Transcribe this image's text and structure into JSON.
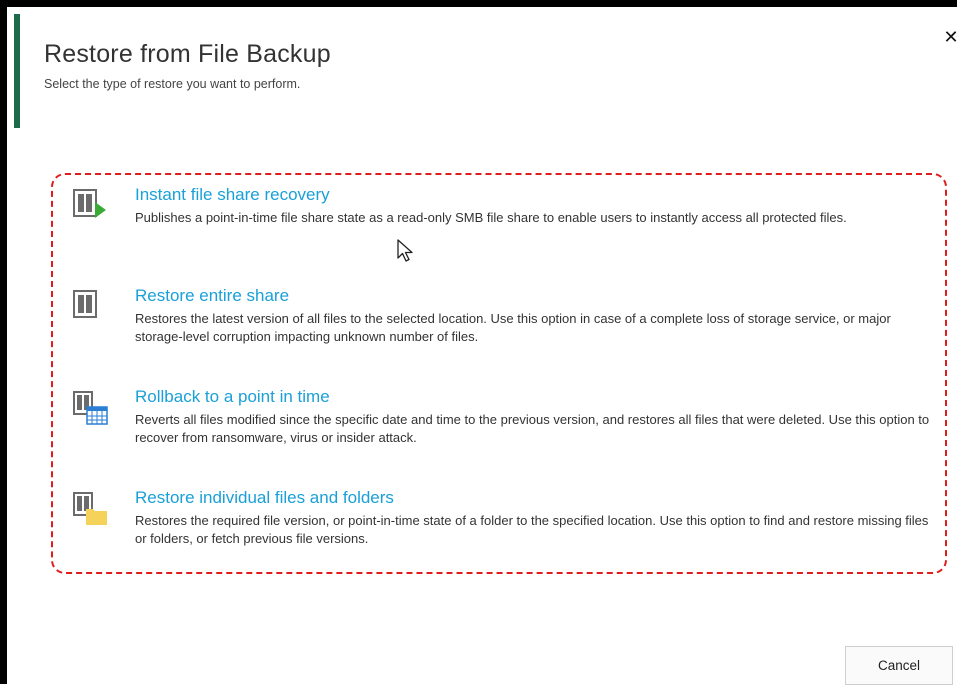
{
  "dialog": {
    "title": "Restore from File Backup",
    "subtitle": "Select the type of restore you want to perform.",
    "close_label": "✕"
  },
  "options": [
    {
      "name": "Instant file share recovery",
      "description": "Publishes a point-in-time file share state as a read-only SMB file share to enable users to instantly access all protected files.",
      "icon": "instant-recovery-icon"
    },
    {
      "name": "Restore entire share",
      "description": "Restores the latest version of all files to the selected location. Use this option in case of a complete loss of storage service, or major storage-level corruption impacting unknown number of files.",
      "icon": "restore-share-icon"
    },
    {
      "name": "Rollback to a point in time",
      "description": "Reverts all files modified since the specific date and time to the previous version, and restores all files that were deleted. Use this option to recover from ransomware, virus or insider attack.",
      "icon": "rollback-calendar-icon"
    },
    {
      "name": "Restore individual files and folders",
      "description": "Restores the required file version, or point-in-time state of a folder to the specified location. Use this option to find and restore missing files or folders, or fetch previous file versions.",
      "icon": "restore-folder-icon"
    }
  ],
  "footer": {
    "cancel_label": "Cancel"
  },
  "colors": {
    "accent": "#1e6b4a",
    "link": "#1aa0d8",
    "highlight_border": "#e01c1c",
    "icon_gray": "#6b6b6b",
    "play_green": "#3aaa35",
    "folder_yellow": "#f5d25a"
  }
}
